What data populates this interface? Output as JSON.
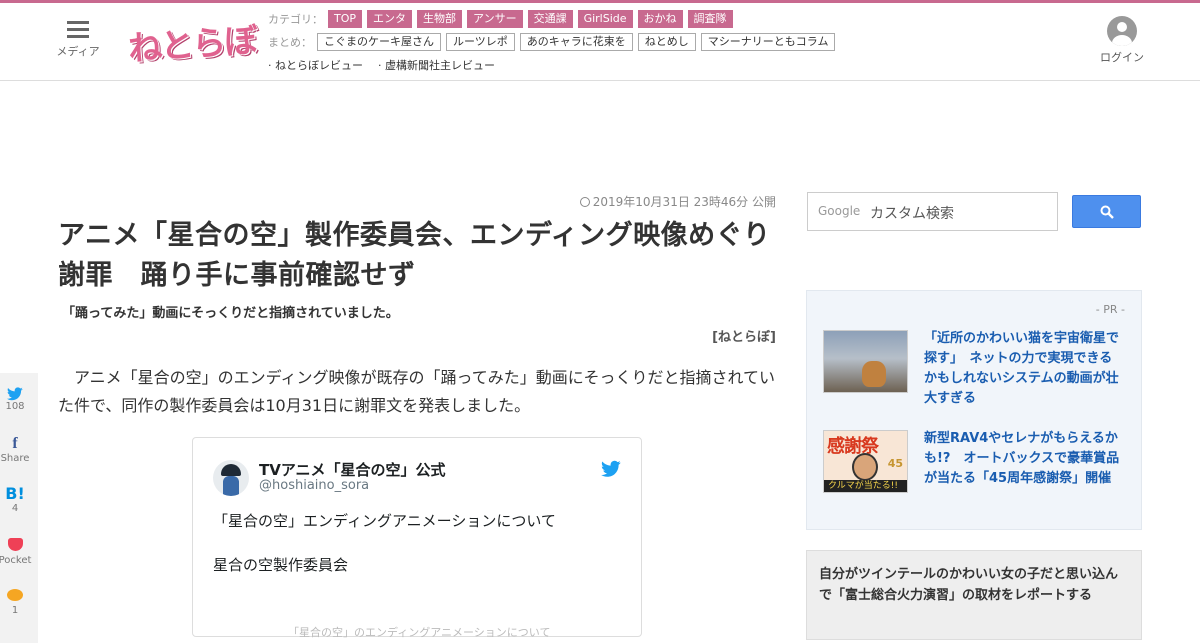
{
  "header": {
    "menu_label": "メディア",
    "logo_text": "ねとらぼ",
    "categories_label": "カテゴリ：",
    "categories": [
      "TOP",
      "エンタ",
      "生物部",
      "アンサー",
      "交通課",
      "GirlSide",
      "おかね",
      "調査隊"
    ],
    "summary_label": "まとめ：",
    "summaries": [
      "こぐまのケーキ屋さん",
      "ルーツレポ",
      "あのキャラに花束を",
      "ねとめし",
      "マシーナリーともコラム"
    ],
    "reviews": [
      "· ねとらぼレビュー",
      "· 虚構新聞社主レビュー"
    ],
    "login_label": "ログイン"
  },
  "article": {
    "published": "2019年10月31日 23時46分 公開",
    "title": "アニメ「星合の空」製作委員会、エンディング映像めぐり謝罪　踊り手に事前確認せず",
    "subtitle": "「踊ってみた」動画にそっくりだと指摘されていました。",
    "source": "[ねとらぼ]",
    "body": "アニメ「星合の空」のエンディング映像が既存の「踊ってみた」動画にそっくりだと指摘されていた件で、同作の製作委員会は10月31日に謝罪文を発表しました。"
  },
  "tweet": {
    "name": "TVアニメ「星合の空」公式",
    "handle": "@hoshiaino_sora",
    "line1": "「星合の空」エンディングアニメーションについて",
    "line2": "星合の空製作委員会",
    "faded": "「星合の空」のエンディングアニメーションについて"
  },
  "share": {
    "twitter_count": "108",
    "facebook_label": "Share",
    "hatena_count": "4",
    "pocket_label": "Pocket",
    "comment_count": "1"
  },
  "sidebar": {
    "search_brand": "Google",
    "search_placeholder": "カスタム検索",
    "pr_label": "- PR -",
    "pr_items": [
      {
        "text": "「近所のかわいい猫を宇宙衛星で探す」　ネットの力で実現できるかもしれないシステムの動画が壮大すぎる"
      },
      {
        "text": "新型RAV4やセレナがもらえるかも!?　オートバックスで豪華賞品が当たる「45周年感謝祭」開催"
      }
    ],
    "thumb2_kanji": "感謝祭",
    "thumb2_num": "45",
    "thumb2_band": "クルマが当たる!!",
    "rank_text": "自分がツインテールのかわいい女の子だと思い込んで「富士総合火力演習」の取材をレポートする"
  },
  "colors": {
    "brand_pink": "#c8698f",
    "link_blue": "#1a5db0",
    "search_blue": "#4e90ee",
    "twitter_blue": "#1da1f2"
  }
}
